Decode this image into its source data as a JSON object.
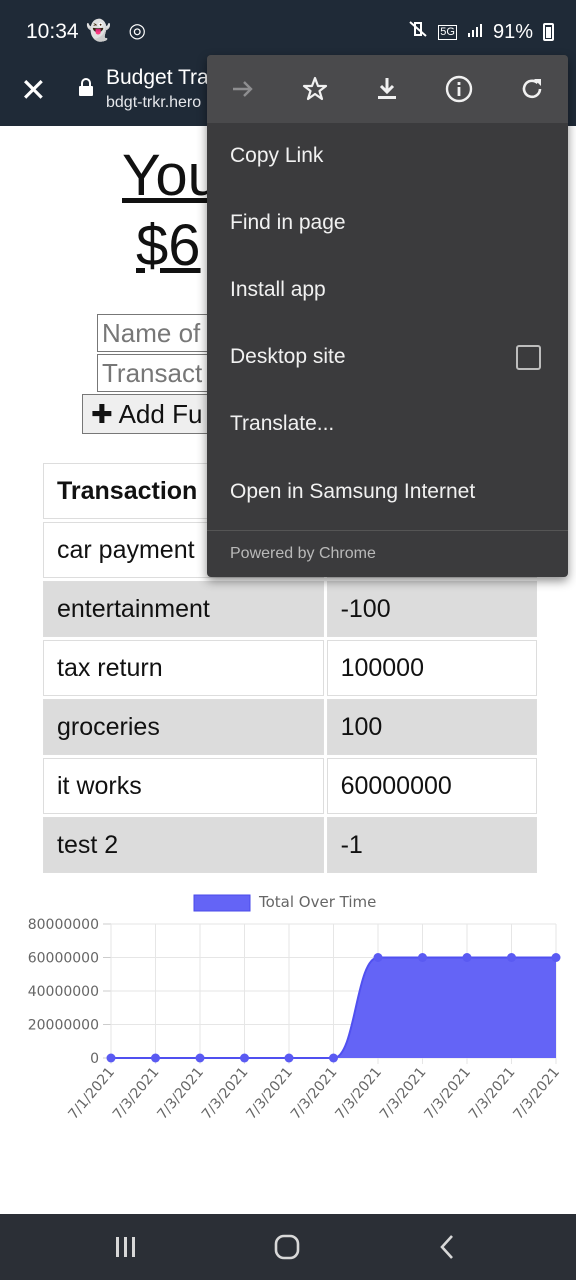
{
  "status_bar": {
    "time": "10:34",
    "battery": "91%",
    "left_icons": [
      "snapchat-icon",
      "instagram-icon"
    ],
    "right_icons": [
      "mute-vibrate-icon",
      "5g-icon",
      "signal-icon"
    ]
  },
  "toolbar": {
    "title": "Budget Tra",
    "url": "bdgt-trkr.hero"
  },
  "page": {
    "heading": "You",
    "amount": "$6",
    "name_placeholder": "Name of",
    "amount_placeholder": "Transact",
    "add_button": "Add Fu",
    "table": {
      "header": "Transaction",
      "rows": [
        {
          "name": "car payment",
          "value": ""
        },
        {
          "name": "entertainment",
          "value": "-100"
        },
        {
          "name": "tax return",
          "value": "100000"
        },
        {
          "name": "groceries",
          "value": "100"
        },
        {
          "name": "it works",
          "value": "60000000"
        },
        {
          "name": "test 2",
          "value": "-1"
        }
      ]
    }
  },
  "menu": {
    "items": [
      "Copy Link",
      "Find in page",
      "Install app",
      "Desktop site",
      "Translate...",
      "Open in Samsung Internet"
    ],
    "desktop_site_checked": false,
    "powered_by": "Powered by Chrome",
    "actions": [
      "forward-icon",
      "star-icon",
      "download-icon",
      "info-icon",
      "refresh-icon"
    ]
  },
  "chart_data": {
    "type": "area",
    "series": [
      {
        "name": "Total Over Time",
        "values": [
          0,
          0,
          0,
          0,
          0,
          0,
          60000000,
          60000000,
          60000000,
          60000000,
          60000000
        ]
      }
    ],
    "categories": [
      "7/1/2021",
      "7/3/2021",
      "7/3/2021",
      "7/3/2021",
      "7/3/2021",
      "7/3/2021",
      "7/3/2021",
      "7/3/2021",
      "7/3/2021",
      "7/3/2021",
      "7/3/2021"
    ],
    "yticks": [
      "80000000",
      "60000000",
      "40000000",
      "20000000",
      "0"
    ],
    "ylim": [
      0,
      80000000
    ],
    "color": "#6464f6",
    "legend": "top",
    "grid": true
  }
}
